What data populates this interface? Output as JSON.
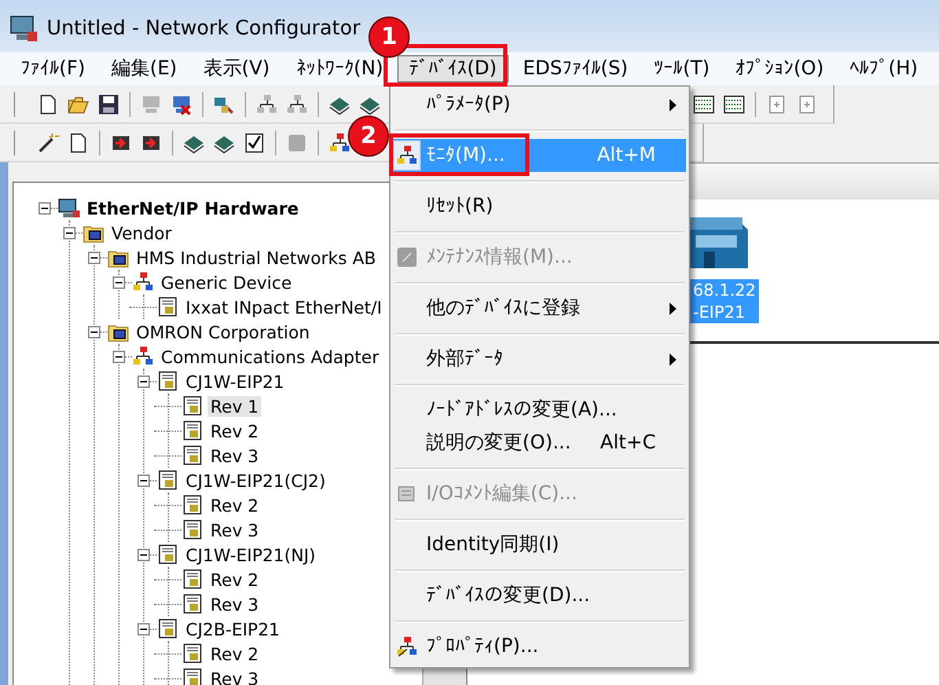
{
  "window": {
    "title": "Untitled - Network Configurator"
  },
  "menu_bar": [
    {
      "label": "ﾌｧｲﾙ(F)",
      "selected": false
    },
    {
      "label": "編集(E)",
      "selected": false
    },
    {
      "label": "表示(V)",
      "selected": false
    },
    {
      "label": "ﾈｯﾄﾜｰｸ(N)",
      "selected": false
    },
    {
      "label": "ﾃﾞﾊﾞｲｽ(D)",
      "selected": true
    },
    {
      "label": "EDSﾌｧｲﾙ(S)",
      "selected": false
    },
    {
      "label": "ﾂｰﾙ(T)",
      "selected": false
    },
    {
      "label": "ｵﾌﾟｼｮﾝ(O)",
      "selected": false
    },
    {
      "label": "ﾍﾙﾌﾟ(H)",
      "selected": false
    }
  ],
  "device_menu": {
    "groups": [
      [
        {
          "label": "ﾊﾟﾗﾒｰﾀ(P)",
          "icon": false,
          "submenu": true,
          "disabled": false,
          "selected": false
        }
      ],
      [
        {
          "label": "ﾓﾆﾀ(M)...",
          "shortcut": "Alt+M",
          "icon": true,
          "submenu": false,
          "disabled": false,
          "selected": true
        }
      ],
      [
        {
          "label": "ﾘｾｯﾄ(R)",
          "icon": false,
          "submenu": false,
          "disabled": false,
          "selected": false
        }
      ],
      [
        {
          "label": "ﾒﾝﾃﾅﾝｽ情報(M)...",
          "icon": true,
          "submenu": false,
          "disabled": true,
          "selected": false
        }
      ],
      [
        {
          "label": "他のﾃﾞﾊﾞｲｽに登録",
          "icon": false,
          "submenu": true,
          "disabled": false,
          "selected": false
        }
      ],
      [
        {
          "label": "外部ﾃﾞｰﾀ",
          "icon": false,
          "submenu": true,
          "disabled": false,
          "selected": false
        }
      ],
      [
        {
          "label": "ﾉｰﾄﾞｱﾄﾞﾚｽの変更(A)...",
          "icon": false,
          "submenu": false,
          "disabled": false,
          "selected": false
        },
        {
          "label": "説明の変更(O)...",
          "shortcut": "Alt+C",
          "icon": false,
          "submenu": false,
          "disabled": false,
          "selected": false
        }
      ],
      [
        {
          "label": "I/Oｺﾒﾝﾄ編集(C)...",
          "icon": true,
          "submenu": false,
          "disabled": true,
          "selected": false
        }
      ],
      [
        {
          "label": "Identity同期(I)",
          "icon": false,
          "submenu": false,
          "disabled": false,
          "selected": false
        }
      ],
      [
        {
          "label": "ﾃﾞﾊﾞｲｽの変更(D)...",
          "icon": false,
          "submenu": false,
          "disabled": false,
          "selected": false
        }
      ],
      [
        {
          "label": "ﾌﾟﾛﾊﾟﾃｨ(P)...",
          "icon": true,
          "submenu": false,
          "disabled": false,
          "selected": false
        }
      ]
    ]
  },
  "tree": {
    "items": [
      {
        "label": "EtherNet/IP Hardware",
        "kind": "hardware",
        "expanded": true,
        "selected": false,
        "children": [
          {
            "label": "Vendor",
            "kind": "folder",
            "expanded": true,
            "selected": false,
            "children": [
              {
                "label": "HMS Industrial Networks AB",
                "kind": "folder",
                "expanded": true,
                "selected": false,
                "children": [
                  {
                    "label": "Generic Device",
                    "kind": "group",
                    "expanded": true,
                    "selected": false,
                    "children": [
                      {
                        "label": "Ixxat INpact EtherNet/I",
                        "kind": "device",
                        "selected": false
                      }
                    ]
                  }
                ]
              },
              {
                "label": "OMRON Corporation",
                "kind": "folder",
                "expanded": true,
                "selected": false,
                "children": [
                  {
                    "label": "Communications Adapter",
                    "kind": "group",
                    "expanded": true,
                    "selected": false,
                    "children": [
                      {
                        "label": "CJ1W-EIP21",
                        "kind": "device",
                        "expanded": true,
                        "selected": false,
                        "children": [
                          {
                            "label": "Rev 1",
                            "kind": "device",
                            "selected": true
                          },
                          {
                            "label": "Rev 2",
                            "kind": "device",
                            "selected": false
                          },
                          {
                            "label": "Rev 3",
                            "kind": "device",
                            "selected": false
                          }
                        ]
                      },
                      {
                        "label": "CJ1W-EIP21(CJ2)",
                        "kind": "device",
                        "expanded": true,
                        "selected": false,
                        "children": [
                          {
                            "label": "Rev 2",
                            "kind": "device",
                            "selected": false
                          },
                          {
                            "label": "Rev 3",
                            "kind": "device",
                            "selected": false
                          }
                        ]
                      },
                      {
                        "label": "CJ1W-EIP21(NJ)",
                        "kind": "device",
                        "expanded": true,
                        "selected": false,
                        "children": [
                          {
                            "label": "Rev 2",
                            "kind": "device",
                            "selected": false
                          },
                          {
                            "label": "Rev 3",
                            "kind": "device",
                            "selected": false
                          }
                        ]
                      },
                      {
                        "label": "CJ2B-EIP21",
                        "kind": "device",
                        "expanded": true,
                        "selected": false,
                        "children": [
                          {
                            "label": "Rev 2",
                            "kind": "device",
                            "selected": false
                          },
                          {
                            "label": "Rev 3",
                            "kind": "device",
                            "selected": false
                          }
                        ]
                      }
                    ]
                  }
                ]
              }
            ]
          }
        ]
      }
    ]
  },
  "canvas": {
    "device": {
      "labels": [
        "68.1.22",
        "-EIP21"
      ],
      "selected": true
    }
  },
  "callouts": [
    {
      "label": "1"
    },
    {
      "label": "2"
    }
  ]
}
